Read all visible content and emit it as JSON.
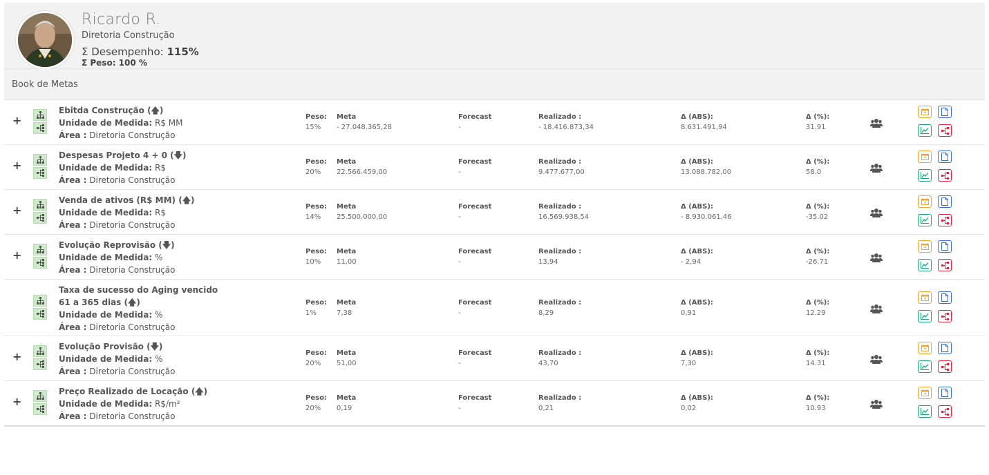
{
  "user": {
    "name": "Ricardo R.",
    "department": "Diretoria Construção",
    "performance_label": "Σ Desempenho:",
    "performance_value": "115%",
    "weight_label": "Σ Peso: 100 %"
  },
  "section": {
    "title": "Book de Metas"
  },
  "labels": {
    "unit": "Unidade de Medida:",
    "area": "Área :",
    "peso": "Peso:",
    "meta": "Meta",
    "forecast": "Forecast",
    "realizado": "Realizado :",
    "delta_abs": "Δ (ABS):",
    "delta_pct": "Δ (%):",
    "expand": "+"
  },
  "colors": {
    "good": "#1ec15c",
    "bad": "#e8203d",
    "calendar": "#f5a623",
    "document": "#3b6fd8",
    "chart": "#1aa77a",
    "share": "#e8203d"
  },
  "goals": [
    {
      "title_lines": [
        "Ebitda Construção (🡅)"
      ],
      "unit": "R$ MM",
      "area": "Diretoria Construção",
      "peso": "15%",
      "meta": "- 27.048.365,28",
      "forecast": "-",
      "realizado": "- 18.416.873,34",
      "status": "good",
      "delta_abs": "8.631.491,94",
      "delta_pct": "31.91",
      "expandable": true
    },
    {
      "title_lines": [
        "Despesas Projeto 4 + 0 (🡇)"
      ],
      "unit": "R$",
      "area": "Diretoria Construção",
      "peso": "20%",
      "meta": "22.566.459,00",
      "forecast": "-",
      "realizado": "9.477.677,00",
      "status": "good",
      "delta_abs": "13.088.782,00",
      "delta_pct": "58.0",
      "expandable": true
    },
    {
      "title_lines": [
        "Venda de ativos (R$ MM) (🡅)"
      ],
      "unit": "R$",
      "area": "Diretoria Construção",
      "peso": "14%",
      "meta": "25.500.000,00",
      "forecast": "-",
      "realizado": "16.569.938,54",
      "status": "bad",
      "delta_abs": "- 8.930.061,46",
      "delta_pct": "-35.02",
      "expandable": true
    },
    {
      "title_lines": [
        "Evolução Reprovisão (🡇)"
      ],
      "unit": "%",
      "area": "Diretoria Construção",
      "peso": "10%",
      "meta": "11,00",
      "forecast": "-",
      "realizado": "13,94",
      "status": "bad",
      "delta_abs": "- 2,94",
      "delta_pct": "-26.71",
      "expandable": true
    },
    {
      "title_lines": [
        "Taxa de sucesso do Aging vencido",
        "61 a 365 dias (🡅)"
      ],
      "unit": "%",
      "area": "Diretoria Construção",
      "peso": "1%",
      "meta": "7,38",
      "forecast": "-",
      "realizado": "8,29",
      "status": "good",
      "delta_abs": "0,91",
      "delta_pct": "12.29",
      "expandable": false
    },
    {
      "title_lines": [
        "Evolução Provisão (🡇)"
      ],
      "unit": "%",
      "area": "Diretoria Construção",
      "peso": "20%",
      "meta": "51,00",
      "forecast": "-",
      "realizado": "43,70",
      "status": "good",
      "delta_abs": "7,30",
      "delta_pct": "14.31",
      "expandable": true
    },
    {
      "title_lines": [
        "Preço Realizado de Locação (🡅)"
      ],
      "unit": "R$/m²",
      "area": "Diretoria Construção",
      "peso": "20%",
      "meta": "0,19",
      "forecast": "-",
      "realizado": "0,21",
      "status": "good",
      "delta_abs": "0,02",
      "delta_pct": "10.93",
      "expandable": true
    }
  ]
}
